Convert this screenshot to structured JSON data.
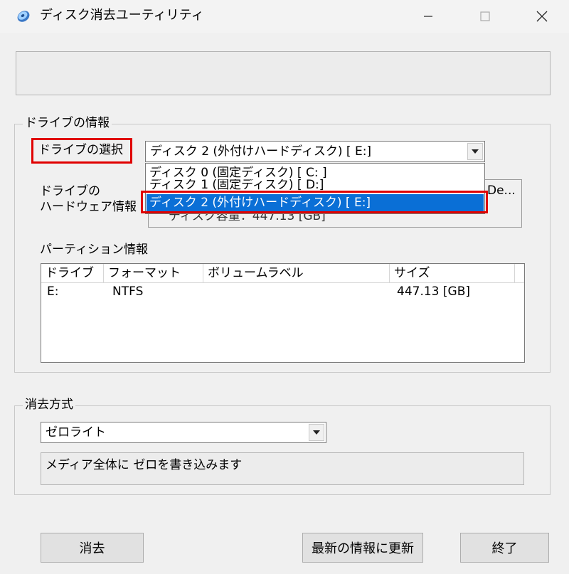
{
  "window": {
    "title": "ディスク消去ユーティリティ",
    "controls": [
      "minimize",
      "maximize",
      "close"
    ]
  },
  "message_text": "",
  "drive_group": {
    "legend": "ドライブの情報",
    "drive_select_label": "ドライブの選択",
    "drive_select_value": "ディスク 2 (外付けハードディスク) [ E:]",
    "drive_options": [
      "ディスク 0 (固定ディスク) [ C: ]",
      "ディスク 1 (固定ディスク) [ D:]",
      "ディスク 2 (外付けハードディスク) [ E:]"
    ],
    "selected_option_index": 2,
    "hardware_label_line1": "ドライブの",
    "hardware_label_line2": "ハードウェア情報",
    "hardware_info_fragment": "De...",
    "hardware_info_partial": "ディスク容量：447.13 [GB]",
    "partition_label": "パーティション情報",
    "partition_columns": [
      "ドライブ",
      "フォーマット",
      "ボリュームラベル",
      "サイズ"
    ],
    "partition_rows": [
      {
        "drive": "E:",
        "format": "NTFS",
        "label": "",
        "size": "447.13 [GB]"
      }
    ]
  },
  "erase_group": {
    "legend": "消去方式",
    "method_value": "ゼロライト",
    "method_description": "メディア全体に ゼロを書き込みます"
  },
  "buttons": {
    "erase": "消去",
    "refresh": "最新の情報に更新",
    "exit": "終了"
  },
  "colors": {
    "highlight_red": "#e00000",
    "selection_blue": "#0a6fd6",
    "window_bg": "#f0f0f0"
  }
}
